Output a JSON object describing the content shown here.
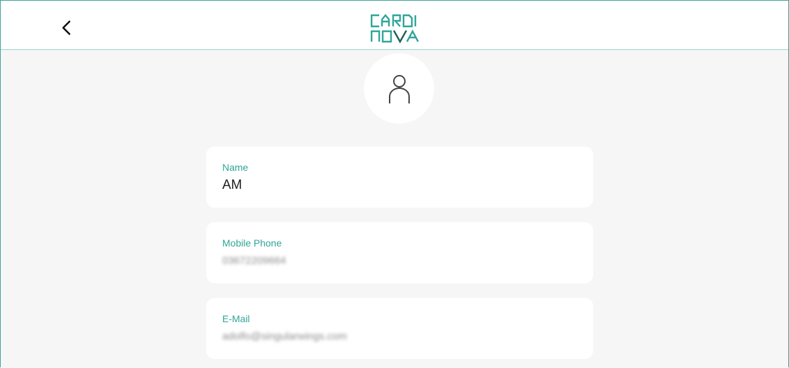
{
  "header": {
    "back_icon": "chevron-left-icon",
    "logo_line1": "CARDI",
    "logo_line2": "NOVA",
    "accent_color": "#2fa59a"
  },
  "profile": {
    "avatar_icon": "user-icon"
  },
  "fields": {
    "name": {
      "label": "Name",
      "value": "AM"
    },
    "mobile": {
      "label": "Mobile Phone",
      "value": "03672209664"
    },
    "email": {
      "label": "E-Mail",
      "value": "adolfo@singularwings.com"
    }
  }
}
